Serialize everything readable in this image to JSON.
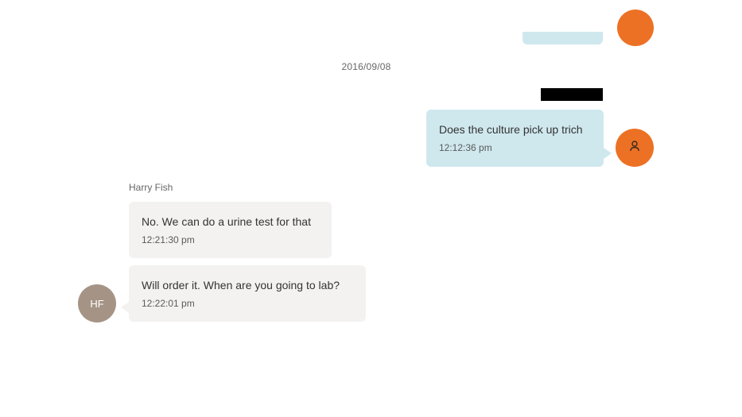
{
  "conversation": {
    "date_divider": "2016/09/08",
    "outgoing_message": {
      "text": "Does the culture pick up trich",
      "time": "12:12:36 pm",
      "avatar_icon": "person-icon"
    },
    "incoming": {
      "sender_name": "Harry Fish",
      "sender_initials": "HF",
      "messages": [
        {
          "text": "No. We can do a urine test for that",
          "time": "12:21:30 pm"
        },
        {
          "text": "Will order it. When are you going to lab?",
          "time": "12:22:01 pm"
        }
      ]
    }
  },
  "colors": {
    "outgoing_bubble": "#cfe8ee",
    "incoming_bubble": "#f3f2f0",
    "user_avatar": "#ec7125",
    "sender_avatar": "#a59485"
  }
}
